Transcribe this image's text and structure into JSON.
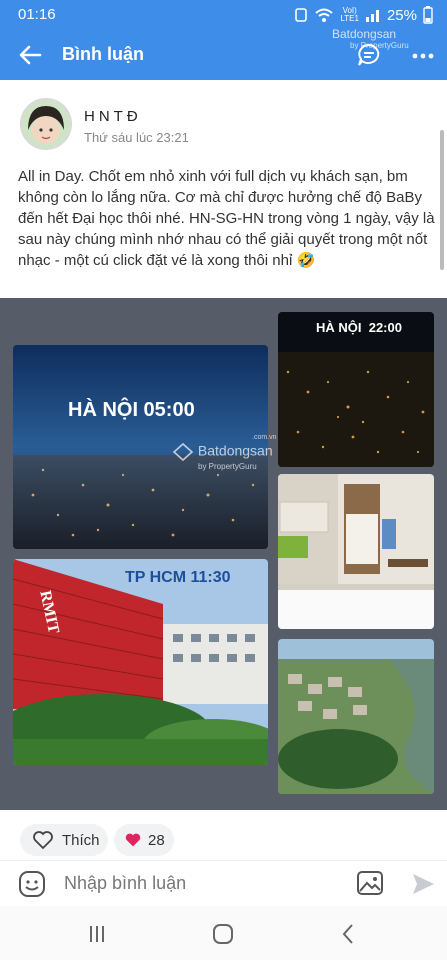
{
  "status": {
    "time": "01:16",
    "network": "LTE1",
    "volte": "VoI)",
    "battery": "25%"
  },
  "appbar": {
    "title": "Bình luận",
    "icons": [
      "back-arrow-icon",
      "chat-icon",
      "more-icon"
    ]
  },
  "watermark": {
    "brand": "Batdongsan",
    "sub": "by PropertyGuru",
    "site": ".com.vn"
  },
  "post": {
    "author": "HNTĐ",
    "timestamp": "Thứ sáu lúc 23:21",
    "text": "All in Day. Chốt em nhỏ xinh với full dịch vụ khách sạn, bm không còn lo lắng nữa. Cơ mà chỉ được hưởng chế độ BaBy đến hết Đại học thôi nhé. HN-SG-HN trong vòng 1 ngày, vậy là sau này chúng mình nhớ nhau có thể giải quyết trong một nốt nhạc - một cú click đặt vé là xong thôi nhỉ 🤣"
  },
  "gallery": {
    "captions": {
      "hanoi_morning": "HÀ NỘI 05:00",
      "hanoi_night": "HÀ NỘI  22:00",
      "hcm": "TP HCM 11:30",
      "rmit": "RMIT"
    }
  },
  "reactions": {
    "like_label": "Thích",
    "heart_count": "28"
  },
  "composer": {
    "placeholder": "Nhập bình luận"
  },
  "colors": {
    "brand_blue": "#3e8de8",
    "heart": "#e0245e"
  }
}
